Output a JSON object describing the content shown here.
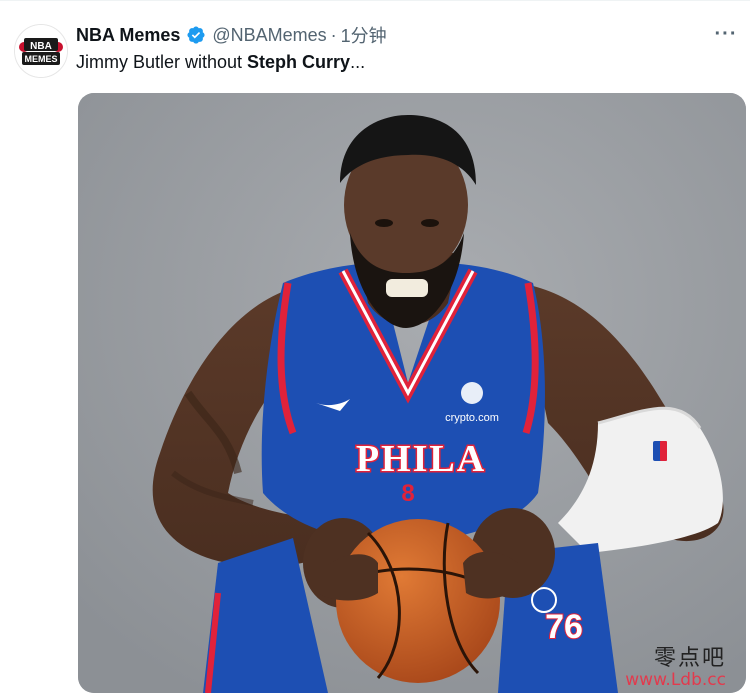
{
  "tweet": {
    "display_name": "NBA Memes",
    "handle": "@NBAMemes",
    "separator": "·",
    "time": "1分钟",
    "text_prefix": "Jimmy Butler without ",
    "text_bold": "Steph Curry",
    "text_suffix": "...",
    "more_label": "···",
    "avatar_logo_text": "NBA MEMES",
    "verified_color": "#1d9bf0"
  },
  "media": {
    "jersey_text": "PHILA",
    "jersey_number": "8",
    "sponsor_text": "crypto.com",
    "shorts_number": "76"
  },
  "watermark": {
    "cn_text": "零点吧",
    "url_text": "www.Ldb.cc"
  },
  "colors": {
    "jersey_blue": "#1d4fb3",
    "jersey_red": "#e0223a",
    "background_gray": "#9a9ea3",
    "accent": "#1d9bf0"
  }
}
